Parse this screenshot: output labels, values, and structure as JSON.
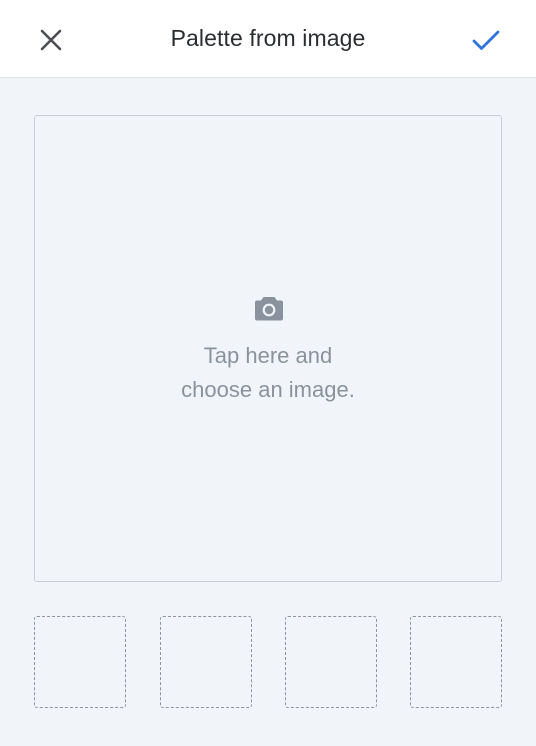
{
  "header": {
    "title": "Palette from image",
    "close_icon": "close-icon",
    "confirm_icon": "checkmark-icon",
    "confirm_color": "#2f73e0"
  },
  "dropzone": {
    "icon": "camera-icon",
    "line1": "Tap here and",
    "line2": "choose an image."
  },
  "swatches": [
    {
      "color": ""
    },
    {
      "color": ""
    },
    {
      "color": ""
    },
    {
      "color": ""
    }
  ],
  "colors": {
    "background": "#f1f4f9",
    "header_bg": "#ffffff",
    "text_muted": "#8a939d",
    "title_text": "#2a2d31"
  }
}
